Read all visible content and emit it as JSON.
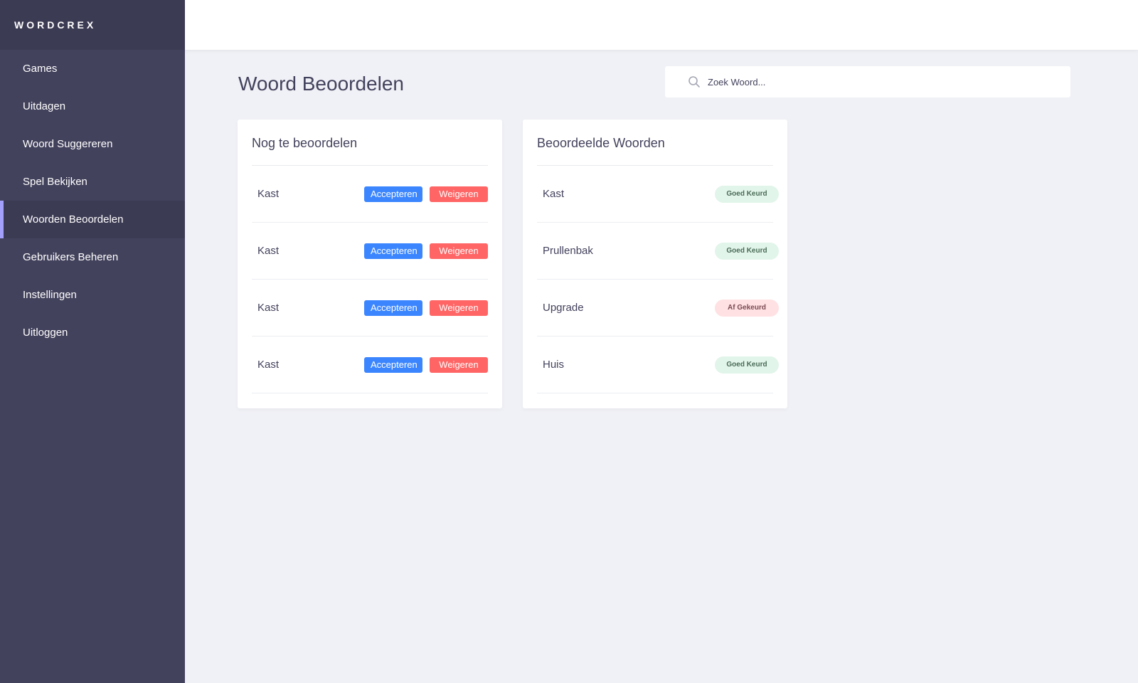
{
  "app": {
    "brand": "WORDCREX"
  },
  "sidebar": {
    "items": [
      {
        "label": "Games",
        "active": false
      },
      {
        "label": "Uitdagen",
        "active": false
      },
      {
        "label": "Woord Suggereren",
        "active": false
      },
      {
        "label": "Spel Bekijken",
        "active": false
      },
      {
        "label": "Woorden Beoordelen",
        "active": true
      },
      {
        "label": "Gebruikers Beheren",
        "active": false
      },
      {
        "label": "Instellingen",
        "active": false
      },
      {
        "label": "Uitloggen",
        "active": false
      }
    ]
  },
  "main": {
    "title": "Woord Beoordelen",
    "search": {
      "placeholder": "Zoek Woord...",
      "value": "",
      "icon": "search-icon"
    },
    "pending": {
      "title": "Nog te beoordelen",
      "accept_label": "Accepteren",
      "reject_label": "Weigeren",
      "rows": [
        {
          "word": "Kast"
        },
        {
          "word": "Kast"
        },
        {
          "word": "Kast"
        },
        {
          "word": "Kast"
        }
      ]
    },
    "reviewed": {
      "title": "Beoordeelde Woorden",
      "rows": [
        {
          "word": "Kast",
          "status": "Goed Keurd",
          "state": "approved"
        },
        {
          "word": "Prullenbak",
          "status": "Goed Keurd",
          "state": "approved"
        },
        {
          "word": "Upgrade",
          "status": "Af Gekeurd",
          "state": "rejected"
        },
        {
          "word": "Huis",
          "status": "Goed Keurd",
          "state": "approved"
        }
      ]
    }
  },
  "colors": {
    "sidebar": "#43425d",
    "sidebar_header": "#3c3b54",
    "active_indicator": "#a3a0fb",
    "accept": "#3b86ff",
    "reject": "#ff6565",
    "approved_badge": "#e2f5ea",
    "rejected_badge": "#ffe1e3",
    "background": "#f0f1f6"
  }
}
